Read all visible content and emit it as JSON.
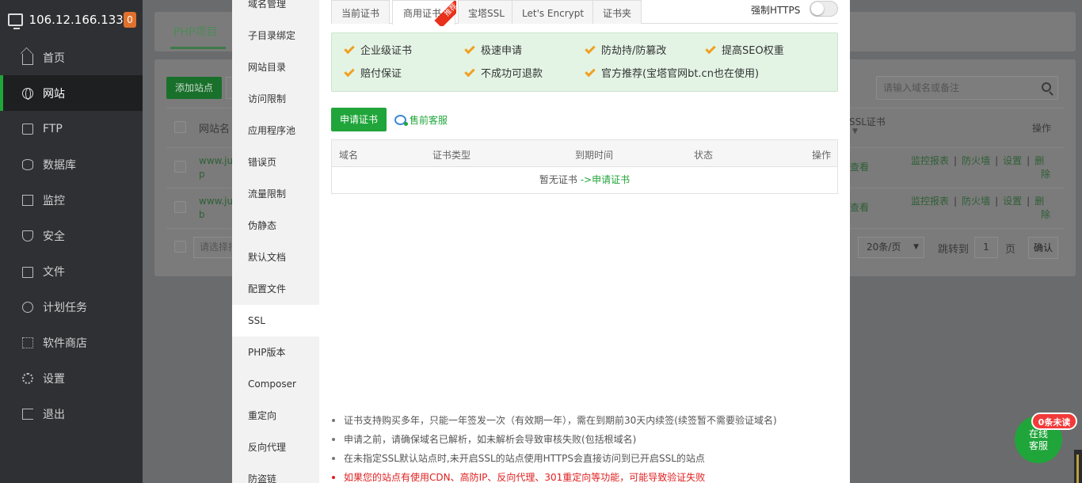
{
  "server": {
    "ip": "106.12.166.133",
    "badge": "0"
  },
  "sidebar": {
    "items": [
      {
        "label": "首页",
        "icon": "home-icon"
      },
      {
        "label": "网站",
        "icon": "globe-icon",
        "active": true
      },
      {
        "label": "FTP",
        "icon": "ftp-icon"
      },
      {
        "label": "数据库",
        "icon": "database-icon"
      },
      {
        "label": "监控",
        "icon": "monitor-icon"
      },
      {
        "label": "安全",
        "icon": "shield-icon"
      },
      {
        "label": "文件",
        "icon": "folder-icon"
      },
      {
        "label": "计划任务",
        "icon": "clock-icon"
      },
      {
        "label": "软件商店",
        "icon": "grid-icon"
      },
      {
        "label": "设置",
        "icon": "gear-icon"
      },
      {
        "label": "退出",
        "icon": "logout-icon"
      }
    ]
  },
  "background_page": {
    "tab": "PHP项目",
    "add_site": "添加站点",
    "search_placeholder": "请输入域名或备注",
    "col_site_name": "网站名",
    "col_ssl": "SSL证书",
    "col_ops": "操作",
    "rows": [
      {
        "site_line1": "www.ju:",
        "site_line2": "p",
        "ssl": "查看"
      },
      {
        "site_line1": "www.ju:",
        "site_line2": "b",
        "ssl": "查看"
      }
    ],
    "ops": {
      "report": "监控报表",
      "firewall": "防火墙",
      "settings": "设置",
      "delete_1": "删",
      "delete_2": "除"
    },
    "batch_placeholder": "请选择批",
    "pager": {
      "per_page": "20条/页",
      "goto_label": "跳转到",
      "page": "1",
      "page_unit": "页",
      "confirm": "确认"
    }
  },
  "dialog": {
    "menu": [
      "域名管理",
      "子目录绑定",
      "网站目录",
      "访问限制",
      "应用程序池",
      "错误页",
      "流量限制",
      "伪静态",
      "默认文档",
      "配置文件",
      "SSL",
      "PHP版本",
      "Composer",
      "重定向",
      "反向代理",
      "防盗链"
    ],
    "active_menu": "SSL",
    "ssl_tabs": [
      "当前证书",
      "商用证书",
      "宝塔SSL",
      "Let's Encrypt",
      "证书夹"
    ],
    "active_tab": "商用证书",
    "ribbon": "推荐",
    "force_https": "强制HTTPS",
    "force_https_on": false,
    "features": [
      "企业级证书",
      "极速申请",
      "防劫持/防篡改",
      "提高SEO权重",
      "赔付保证",
      "不成功可退款",
      "官方推荐(宝塔官网bt.cn也在使用)"
    ],
    "apply_button": "申请证书",
    "presale": "售前客服",
    "table_headers": [
      "域名",
      "证书类型",
      "到期时间",
      "状态",
      "操作"
    ],
    "empty_text": "暂无证书",
    "empty_link": "->申请证书",
    "notes": [
      "证书支持购买多年，只能一年签发一次（有效期一年），需在到期前30天内续签(续签暂不需要验证域名)",
      "申请之前，请确保域名已解析，如未解析会导致审核失败(包括根域名)",
      "在未指定SSL默认站点时,未开启SSL的站点使用HTTPS会直接访问到已开启SSL的站点"
    ],
    "warning": "如果您的站点有使用CDN、高防IP、反向代理、301重定向等功能，可能导致验证失败"
  },
  "chat": {
    "line1": "在线",
    "line2": "客服",
    "unread": "0条未读"
  },
  "colors": {
    "accent": "#20a53a",
    "warn": "#e02020",
    "check": "#f0a020",
    "sidebar": "#2f3033"
  }
}
